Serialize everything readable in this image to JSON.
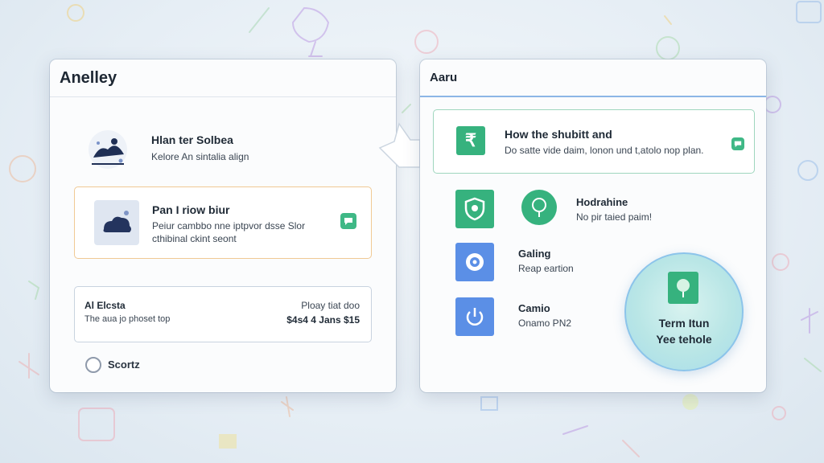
{
  "left_panel": {
    "title": "Anelley",
    "item1": {
      "title": "Hlan ter Solbea",
      "subtitle": "Kelore An sintalia align"
    },
    "card_orange": {
      "title": "Pan I riow biur",
      "subtitle_line1": "Peiur cambbo nne iptpvor dsse Slor",
      "subtitle_line2": "cthibinal ckint seont",
      "badge_icon": "chat-icon"
    },
    "card_gray": {
      "left_title": "Al Elcsta",
      "left_sub": "The aua jo phoset top",
      "right_title": "Ploay tiat doo",
      "right_value": "$4s4 4 Jans $15"
    },
    "radio_label": "Scortz"
  },
  "right_panel": {
    "title": "Aaru",
    "card_green": {
      "title": "How the shubitt and",
      "subtitle": "Do satte vide daim, lonon und t,atolo nop plan.",
      "badge_icon": "chat-icon"
    },
    "item_hodrahine": {
      "title": "Hodrahine",
      "subtitle": "No pir taied paim!"
    },
    "item_galing": {
      "title": "Galing",
      "subtitle": "Reap eartion"
    },
    "item_camio": {
      "title": "Camio",
      "subtitle": "Onamo PN2"
    },
    "circle": {
      "line1": "Term Itun",
      "line2": "Yee tehole"
    }
  },
  "colors": {
    "green": "#36b27e",
    "blue": "#5b8fe6",
    "orange_border": "#f0c994",
    "header_accent": "#8cb6e6"
  }
}
